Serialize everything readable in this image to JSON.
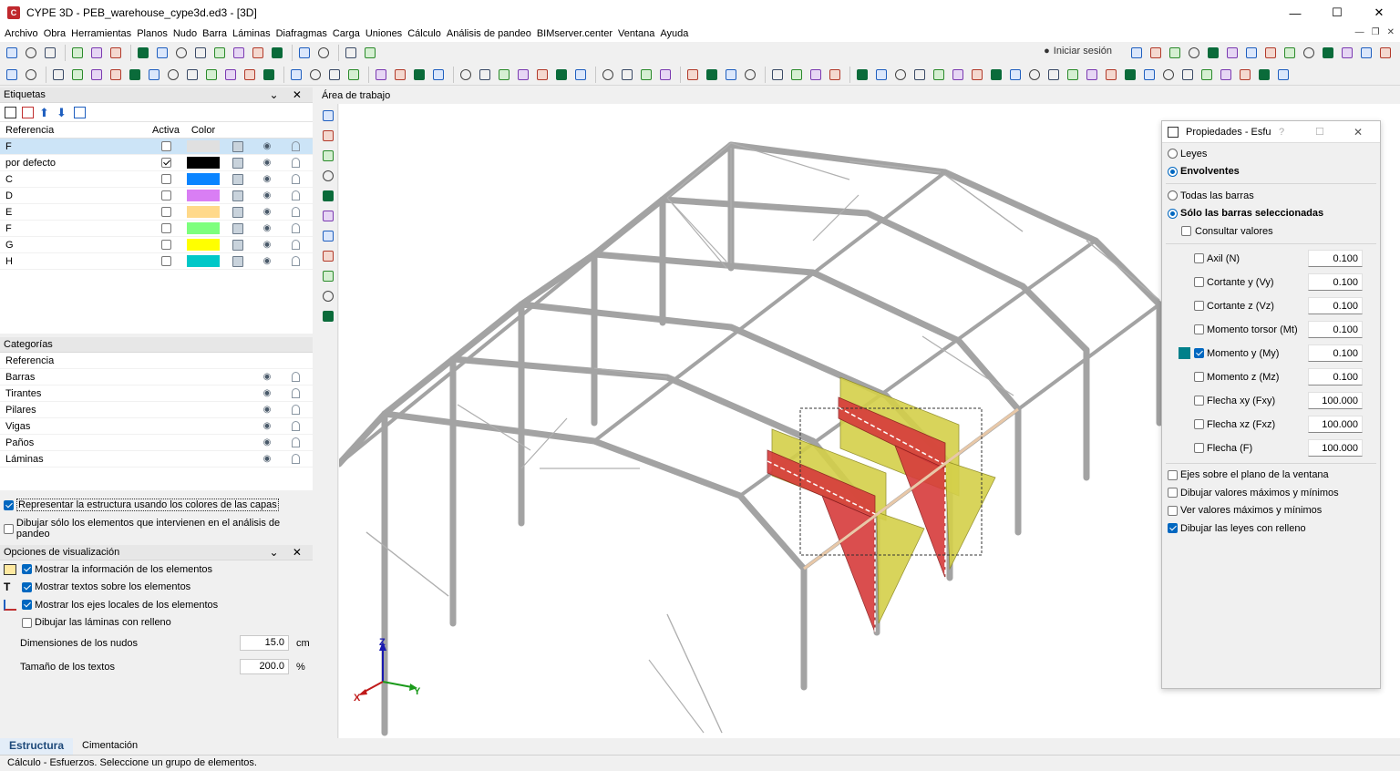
{
  "window": {
    "title": "CYPE 3D - PEB_warehouse_cype3d.ed3 - [3D]",
    "app_icon_letter": "C"
  },
  "menu": [
    "Archivo",
    "Obra",
    "Herramientas",
    "Planos",
    "Nudo",
    "Barra",
    "Láminas",
    "Diafragmas",
    "Carga",
    "Uniones",
    "Cálculo",
    "Análisis de pandeo",
    "BIMserver.center",
    "Ventana",
    "Ayuda"
  ],
  "toolbar": {
    "signin_label": "Iniciar sesión"
  },
  "etiquetas": {
    "title": "Etiquetas",
    "columns": {
      "ref": "Referencia",
      "active": "Activa",
      "color": "Color"
    },
    "rows": [
      {
        "ref": "F",
        "active": false,
        "color": "#e0e0e0",
        "selected": true
      },
      {
        "ref": "por defecto",
        "active": true,
        "color": "#000000"
      },
      {
        "ref": "C",
        "active": false,
        "color": "#0a84ff"
      },
      {
        "ref": "D",
        "active": false,
        "color": "#d97ef4"
      },
      {
        "ref": "E",
        "active": false,
        "color": "#ffd98a"
      },
      {
        "ref": "F",
        "active": false,
        "color": "#7dff7d"
      },
      {
        "ref": "G",
        "active": false,
        "color": "#ffff00"
      },
      {
        "ref": "H",
        "active": false,
        "color": "#00c8c8"
      }
    ]
  },
  "categorias": {
    "title": "Categorías",
    "ref_header": "Referencia",
    "rows": [
      "Barras",
      "Tirantes",
      "Pilares",
      "Vigas",
      "Paños",
      "Láminas"
    ]
  },
  "options": {
    "represent_colors": {
      "label": "Representar la estructura usando los colores de las capas",
      "checked": true
    },
    "draw_buckling_only": {
      "label": "Dibujar sólo los elementos que intervienen en el análisis de pandeo",
      "checked": false
    }
  },
  "visualizacion": {
    "title": "Opciones de visualización",
    "checks": [
      {
        "icon_name": "info-icon",
        "label": "Mostrar la información de los elementos",
        "checked": true
      },
      {
        "icon_name": "text-icon",
        "label": "Mostrar textos sobre los elementos",
        "checked": true
      },
      {
        "icon_name": "local-axes-icon",
        "label": "Mostrar los ejes locales de los elementos",
        "checked": true
      },
      {
        "icon_name": "",
        "label": "Dibujar las láminas con relleno",
        "checked": false
      }
    ],
    "node_dim": {
      "label": "Dimensiones de los nudos",
      "value": "15.0",
      "unit": "cm"
    },
    "text_size": {
      "label": "Tamaño de los textos",
      "value": "200.0",
      "unit": "%"
    }
  },
  "workarea": {
    "title": "Área de trabajo",
    "axes": {
      "x": "X",
      "y": "Y",
      "z": "Z"
    }
  },
  "props": {
    "title": "Propiedades - Esfu",
    "mode": [
      {
        "label": "Leyes",
        "on": false
      },
      {
        "label": "Envolventes",
        "on": true,
        "bold": true
      }
    ],
    "scope": [
      {
        "label": "Todas las barras",
        "on": false
      },
      {
        "label": "Sólo las barras seleccionadas",
        "on": true,
        "bold": true
      }
    ],
    "consult": {
      "label": "Consultar valores",
      "checked": false
    },
    "efforts": [
      {
        "label": "Axil (N)",
        "value": "0.100",
        "checked": false
      },
      {
        "label": "Cortante y (Vy)",
        "value": "0.100",
        "checked": false
      },
      {
        "label": "Cortante z (Vz)",
        "value": "0.100",
        "checked": false
      },
      {
        "label": "Momento torsor (Mt)",
        "value": "0.100",
        "checked": false
      },
      {
        "label": "Momento y (My)",
        "value": "0.100",
        "checked": true,
        "color": "#00808a"
      },
      {
        "label": "Momento z (Mz)",
        "value": "0.100",
        "checked": false
      },
      {
        "label": "Flecha xy (Fxy)",
        "value": "100.000",
        "checked": false
      },
      {
        "label": "Flecha xz (Fxz)",
        "value": "100.000",
        "checked": false
      },
      {
        "label": "Flecha (F)",
        "value": "100.000",
        "checked": false
      }
    ],
    "bottom": [
      {
        "label": "Ejes sobre el plano de la ventana",
        "checked": false
      },
      {
        "label": "Dibujar valores máximos y mínimos",
        "checked": false
      },
      {
        "label": "Ver valores máximos y mínimos",
        "checked": false
      },
      {
        "label": "Dibujar las leyes con relleno",
        "checked": true
      }
    ]
  },
  "tabs": [
    {
      "label": "Estructura",
      "active": true
    },
    {
      "label": "Cimentación",
      "active": false
    }
  ],
  "status": "Cálculo - Esfuerzos. Seleccione un grupo de elementos.",
  "colors": {
    "diagram_positive": "#d4d04a",
    "diagram_negative": "#d63b3b",
    "structure": "#9a9a9a",
    "accent": "#0067c0"
  }
}
